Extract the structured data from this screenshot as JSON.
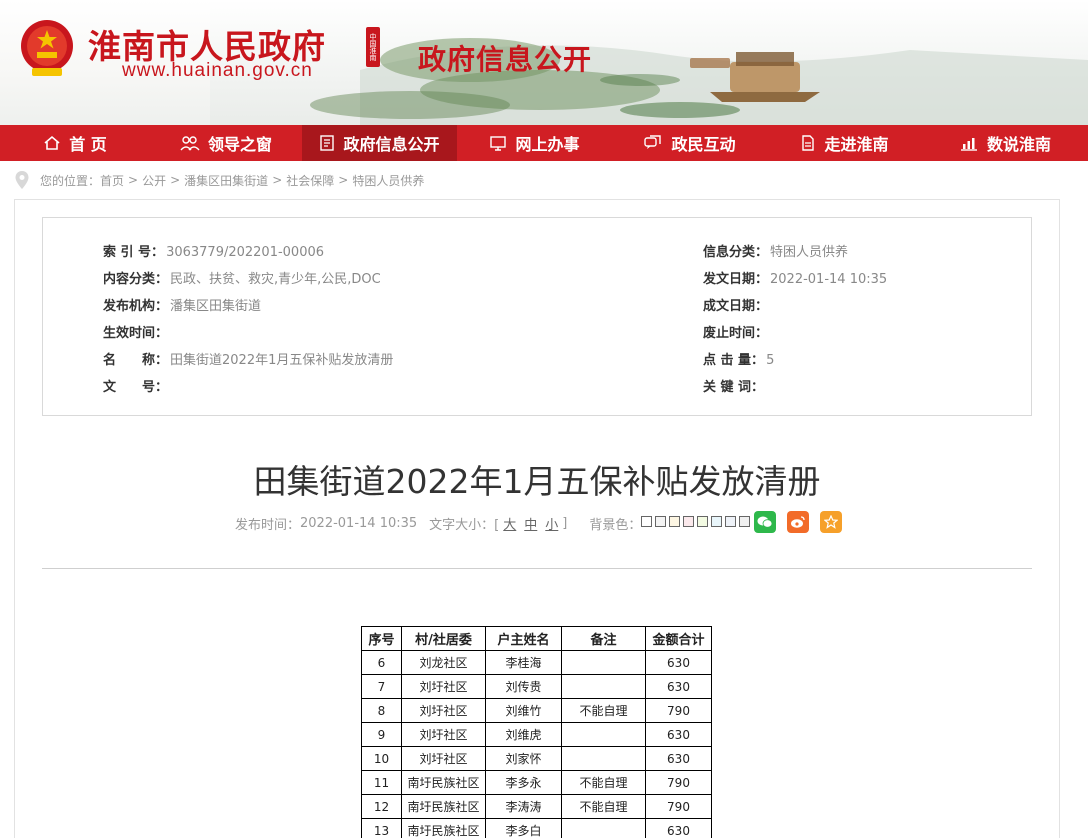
{
  "header": {
    "site_name": "淮南市人民政府",
    "site_url": "www.huainan.gov.cn",
    "seal_text": "中国淮南",
    "section_title": "政府信息公开"
  },
  "nav": {
    "items": [
      {
        "label": "首 页",
        "icon": "home-icon"
      },
      {
        "label": "领导之窗",
        "icon": "people-icon"
      },
      {
        "label": "政府信息公开",
        "icon": "document-icon",
        "active": true
      },
      {
        "label": "网上办事",
        "icon": "monitor-icon"
      },
      {
        "label": "政民互动",
        "icon": "chat-icon"
      },
      {
        "label": "走进淮南",
        "icon": "page-icon"
      },
      {
        "label": "数说淮南",
        "icon": "bar-chart-icon"
      }
    ]
  },
  "breadcrumb": {
    "prefix": "您的位置：",
    "items": [
      "首页",
      "公开",
      "潘集区田集街道",
      "社会保障",
      "特困人员供养"
    ],
    "separator": ">"
  },
  "meta": {
    "left": [
      {
        "label": "索 引 号：",
        "value": "3063779/202201-00006"
      },
      {
        "label": "内容分类：",
        "value": "民政、扶贫、救灾,青少年,公民,DOC"
      },
      {
        "label": "发布机构：",
        "value": "潘集区田集街道"
      },
      {
        "label": "生效时间：",
        "value": ""
      },
      {
        "label": "名　　称：",
        "value": "田集街道2022年1月五保补贴发放清册"
      },
      {
        "label": "文　　号：",
        "value": ""
      }
    ],
    "right": [
      {
        "label": "信息分类：",
        "value": "特困人员供养"
      },
      {
        "label": "发文日期：",
        "value": "2022-01-14 10:35"
      },
      {
        "label": "成文日期：",
        "value": ""
      },
      {
        "label": "废止时间：",
        "value": ""
      },
      {
        "label": "点 击 量：",
        "value": "5"
      },
      {
        "label": "关 键 词：",
        "value": ""
      }
    ]
  },
  "article": {
    "title": "田集街道2022年1月五保补贴发放清册",
    "publish_label": "发布时间：",
    "publish_time": "2022-01-14 10:35",
    "font_size_label": "文字大小：[",
    "font_size_close": "]",
    "font_sizes": [
      "大",
      "中",
      "小"
    ],
    "bg_label": "背景色：",
    "bg_colors": [
      "#ffffff",
      "#f4f4f4",
      "#fdf6e3",
      "#fbe9ec",
      "#f3fbe3",
      "#e9f6fb",
      "#eef2f8",
      "#f0f0f0"
    ]
  },
  "share": [
    {
      "icon": "wechat-icon",
      "color": "#2eb84b"
    },
    {
      "icon": "weibo-icon",
      "color": "#f26b29"
    },
    {
      "icon": "favorite-star-icon",
      "color": "#f6a02a"
    }
  ],
  "table": {
    "headers": [
      "序号",
      "村/社居委",
      "户主姓名",
      "备注",
      "金额合计"
    ],
    "rows": [
      [
        "6",
        "刘龙社区",
        "李桂海",
        "",
        "630"
      ],
      [
        "7",
        "刘圩社区",
        "刘传贵",
        "",
        "630"
      ],
      [
        "8",
        "刘圩社区",
        "刘维竹",
        "不能自理",
        "790"
      ],
      [
        "9",
        "刘圩社区",
        "刘维虎",
        "",
        "630"
      ],
      [
        "10",
        "刘圩社区",
        "刘家怀",
        "",
        "630"
      ],
      [
        "11",
        "南圩民族社区",
        "李多永",
        "不能自理",
        "790"
      ],
      [
        "12",
        "南圩民族社区",
        "李涛涛",
        "不能自理",
        "790"
      ],
      [
        "13",
        "南圩民族社区",
        "李多白",
        "",
        "630"
      ]
    ]
  }
}
